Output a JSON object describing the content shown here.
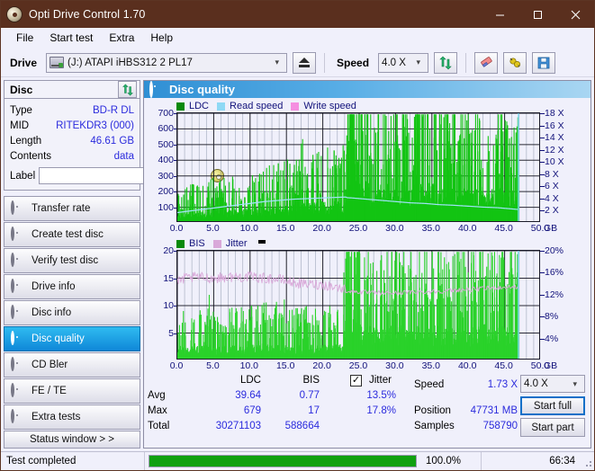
{
  "window": {
    "title": "Opti Drive Control 1.70",
    "icon": "disc-icon",
    "minimize": "minimize-icon",
    "maximize": "maximize-icon",
    "close": "close-icon"
  },
  "menu": {
    "items": [
      "File",
      "Start test",
      "Extra",
      "Help"
    ]
  },
  "toolbar": {
    "drive_label": "Drive",
    "drive_value": "(J:)  ATAPI iHBS312  2 PL17",
    "eject_icon": "eject-icon",
    "speed_label": "Speed",
    "speed_value": "4.0 X",
    "refresh_icon": "refresh-icon",
    "eraser_icon": "eraser-icon",
    "bug_icon": "bug-icon",
    "save_icon": "save-icon"
  },
  "disc": {
    "header": "Disc",
    "refresh_icon": "refresh-icon",
    "rows": [
      {
        "key": "Type",
        "value": "BD-R DL"
      },
      {
        "key": "MID",
        "value": "RITEKDR3 (000)"
      },
      {
        "key": "Length",
        "value": "46.61 GB"
      },
      {
        "key": "Contents",
        "value": "data"
      }
    ],
    "label_key": "Label",
    "label_value": "",
    "label_placeholder": "",
    "label_button_icon": "cd-icon"
  },
  "nav": {
    "items": [
      {
        "label": "Transfer rate",
        "icon": "disc-icon",
        "active": false
      },
      {
        "label": "Create test disc",
        "icon": "disc-icon",
        "active": false
      },
      {
        "label": "Verify test disc",
        "icon": "disc-icon",
        "active": false
      },
      {
        "label": "Drive info",
        "icon": "disc-icon",
        "active": false
      },
      {
        "label": "Disc info",
        "icon": "disc-icon",
        "active": false
      },
      {
        "label": "Disc quality",
        "icon": "disc-icon",
        "active": true
      },
      {
        "label": "CD Bler",
        "icon": "disc-icon",
        "active": false
      },
      {
        "label": "FE / TE",
        "icon": "disc-icon",
        "active": false
      },
      {
        "label": "Extra tests",
        "icon": "disc-icon",
        "active": false
      }
    ],
    "status_window": "Status window > >"
  },
  "panel": {
    "title": "Disc quality",
    "icon": "disc-icon"
  },
  "stats": {
    "col_ldc": "LDC",
    "col_bis": "BIS",
    "jitter_label": "Jitter",
    "jitter_checked": true,
    "row_avg": "Avg",
    "row_max": "Max",
    "row_total": "Total",
    "ldc_avg": "39.64",
    "ldc_max": "679",
    "ldc_total": "30271103",
    "bis_avg": "0.77",
    "bis_max": "17",
    "bis_total": "588664",
    "jitter_avg": "13.5%",
    "jitter_max": "17.8%",
    "speed_label": "Speed",
    "speed_value": "1.73 X",
    "position_label": "Position",
    "position_value": "47731 MB",
    "samples_label": "Samples",
    "samples_value": "758790",
    "speed_select": "4.0 X",
    "start_full": "Start full",
    "start_part": "Start part"
  },
  "statusbar": {
    "message": "Test completed",
    "percent_text": "100.0%",
    "percent_value": 100,
    "elapsed": "66:34"
  },
  "colors": {
    "title_bar": "#5a2f1e",
    "accent": "#1170c8",
    "ldc_green": "#13c413",
    "bis_green": "#13c413",
    "read_speed": "#8fd9f5",
    "write_speed": "#f58fe0",
    "jitter": "#d9a8d9",
    "plot_bg": "#616d86",
    "value_blue": "#2b2bdd",
    "progress_green": "#10a010"
  },
  "chart_data": [
    {
      "type": "line",
      "id": "ldc-chart",
      "title": "",
      "legend": [
        {
          "label": "LDC",
          "color": "#0a8a0a"
        },
        {
          "label": "Read speed",
          "color": "#8fd9f5"
        },
        {
          "label": "Write speed",
          "color": "#f58fe0"
        }
      ],
      "legend_position": "top-left",
      "grid": true,
      "xlabel": "GB",
      "xlim": [
        0,
        50
      ],
      "xticks": [
        0.0,
        5.0,
        10.0,
        15.0,
        20.0,
        25.0,
        30.0,
        35.0,
        40.0,
        45.0,
        50.0
      ],
      "xticklabels": [
        "0.0",
        "5.0",
        "10.0",
        "15.0",
        "20.0",
        "25.0",
        "30.0",
        "35.0",
        "40.0",
        "45.0",
        "50.0"
      ],
      "ylabel": "",
      "ylim": [
        0,
        700
      ],
      "yticks": [
        100,
        200,
        300,
        400,
        500,
        600,
        700
      ],
      "yticklabels": [
        "100",
        "200",
        "300",
        "400",
        "500",
        "600",
        "700"
      ],
      "y2label": "",
      "y2lim": [
        0,
        18
      ],
      "y2ticks": [
        2,
        4,
        6,
        8,
        10,
        12,
        14,
        16,
        18
      ],
      "y2ticklabels": [
        "2 X",
        "4 X",
        "6 X",
        "8 X",
        "10 X",
        "12 X",
        "14 X",
        "16 X",
        "18 X"
      ],
      "data_end_gb": 46.9,
      "series": [
        {
          "name": "LDC",
          "type": "bar",
          "color": "#13c413",
          "axis": "left",
          "x": [
            0.3,
            0.8,
            1.3,
            1.8,
            2.3,
            2.8,
            3.3,
            3.8,
            4.3,
            4.8,
            5.3,
            5.8,
            6.3,
            6.8,
            7.3,
            7.8,
            8.3,
            8.8,
            9.3,
            9.8,
            10.3,
            10.8,
            11.3,
            11.8,
            12.3,
            12.8,
            13.3,
            13.8,
            14.3,
            14.8,
            15.3,
            15.8,
            16.3,
            16.8,
            17.3,
            17.8,
            18.3,
            18.8,
            19.3,
            19.8,
            20.3,
            20.8,
            21.3,
            21.8,
            22.3,
            22.8,
            23.1,
            23.3,
            23.5,
            23.7,
            23.9,
            24.1,
            24.4,
            24.8,
            25.2,
            25.6,
            26.0,
            26.5,
            27.0,
            27.5,
            28.0,
            28.5,
            29.0,
            29.5,
            30.0,
            30.5,
            31.0,
            31.5,
            32.0,
            32.5,
            33.0,
            33.5,
            34.0,
            34.5,
            35.0,
            35.5,
            36.0,
            36.5,
            37.0,
            37.5,
            38.0,
            38.5,
            39.0,
            39.5,
            40.0,
            40.5,
            41.0,
            41.5,
            42.0,
            42.5,
            43.0,
            43.5,
            44.0,
            44.5,
            45.0,
            45.5,
            46.0,
            46.5,
            46.9
          ],
          "baseline": [
            60,
            70,
            75,
            80,
            85,
            90,
            85,
            80,
            90,
            95,
            95,
            100,
            95,
            90,
            95,
            100,
            100,
            105,
            105,
            110,
            110,
            115,
            110,
            115,
            120,
            120,
            125,
            125,
            130,
            130,
            135,
            135,
            140,
            140,
            145,
            145,
            150,
            150,
            155,
            155,
            160,
            160,
            165,
            165,
            170,
            170,
            175,
            300,
            260,
            420,
            690,
            650,
            620,
            520,
            470,
            300,
            330,
            260,
            230,
            310,
            280,
            250,
            300,
            230,
            260,
            300,
            340,
            280,
            230,
            260,
            430,
            300,
            260,
            300,
            340,
            260,
            230,
            250,
            280,
            230,
            260,
            240,
            230,
            250,
            260,
            230,
            250,
            230,
            260,
            240,
            250,
            230,
            260,
            240,
            230,
            250,
            230,
            240,
            230
          ],
          "spikes_note": "dense vertical bars from 0 to data end; error rate rises sharply after 23.1 GB (layer break), peaks near 690 around 24 GB"
        },
        {
          "name": "Read speed",
          "type": "line",
          "color": "#9fe3f8",
          "axis": "right",
          "x": [
            0.0,
            2.0,
            4.0,
            6.0,
            8.0,
            10.0,
            12.0,
            14.0,
            16.0,
            18.0,
            20.0,
            22.0,
            23.2,
            23.3,
            24.0,
            26.0,
            28.0,
            30.0,
            32.0,
            34.0,
            36.0,
            38.0,
            40.0,
            42.0,
            44.0,
            46.0,
            46.9
          ],
          "values": [
            1.7,
            2.0,
            2.3,
            2.6,
            2.9,
            3.2,
            3.5,
            3.7,
            3.9,
            4.0,
            4.1,
            4.2,
            4.25,
            4.15,
            4.1,
            3.9,
            3.7,
            3.5,
            3.3,
            3.2,
            3.0,
            2.9,
            2.75,
            2.6,
            2.5,
            2.3,
            2.2
          ]
        },
        {
          "name": "Write speed",
          "type": "line",
          "color": "#f58fe0",
          "axis": "right",
          "x": [],
          "values": []
        }
      ]
    },
    {
      "type": "line",
      "id": "bis-jitter-chart",
      "title": "",
      "legend": [
        {
          "label": "BIS",
          "color": "#0a8a0a"
        },
        {
          "label": "Jitter",
          "color": "#d9a8d9"
        }
      ],
      "legend_position": "top-left",
      "grid": true,
      "xlabel": "GB",
      "xlim": [
        0,
        50
      ],
      "xticks": [
        0.0,
        5.0,
        10.0,
        15.0,
        20.0,
        25.0,
        30.0,
        35.0,
        40.0,
        45.0,
        50.0
      ],
      "xticklabels": [
        "0.0",
        "5.0",
        "10.0",
        "15.0",
        "20.0",
        "25.0",
        "30.0",
        "35.0",
        "40.0",
        "45.0",
        "50.0"
      ],
      "ylim": [
        0,
        20
      ],
      "yticks": [
        5,
        10,
        15,
        20
      ],
      "yticklabels": [
        "5",
        "10",
        "15",
        "20"
      ],
      "y2lim": [
        0,
        20
      ],
      "y2ticks": [
        4,
        8,
        12,
        16,
        20
      ],
      "y2ticklabels": [
        "4%",
        "8%",
        "12%",
        "16%",
        "20%"
      ],
      "data_end_gb": 46.9,
      "series": [
        {
          "name": "BIS",
          "type": "bar",
          "color": "#13c413",
          "axis": "left",
          "x": [
            0.5,
            1.5,
            2.5,
            3.5,
            4.5,
            5.5,
            6.5,
            7.5,
            8.5,
            9.5,
            10.5,
            11.5,
            12.5,
            13.5,
            14.5,
            15.5,
            16.5,
            17.5,
            18.5,
            19.5,
            20.5,
            21.5,
            22.5,
            23.2,
            23.5,
            24.0,
            25.0,
            26.0,
            27.0,
            28.0,
            29.0,
            30.0,
            31.0,
            32.0,
            33.0,
            34.0,
            35.0,
            36.0,
            37.0,
            38.0,
            39.0,
            40.0,
            41.0,
            42.0,
            43.0,
            44.0,
            45.0,
            46.0,
            46.9
          ],
          "baseline": [
            3,
            3,
            3,
            3.2,
            3.2,
            3,
            3,
            3.2,
            3.2,
            3.2,
            3.2,
            3.5,
            3.5,
            3.5,
            3.2,
            3.2,
            3.2,
            3.2,
            3.2,
            3.2,
            3.2,
            3.5,
            3.5,
            11,
            17,
            12,
            8,
            7,
            7,
            6.5,
            7,
            8,
            7,
            6.5,
            7,
            7,
            7.5,
            7,
            7,
            6.5,
            7,
            7,
            7,
            7.5,
            7,
            7,
            7,
            7,
            6.5
          ],
          "spikes_note": "dense low green bars ~3-5 before 23 GB, rising to ~6-8 after layer change with occasional spikes to 16"
        },
        {
          "name": "Jitter",
          "type": "line",
          "color": "#d9a8d9",
          "axis": "right",
          "x": [
            0.0,
            0.5,
            1.0,
            2.0,
            3.0,
            4.0,
            5.0,
            6.0,
            7.0,
            8.0,
            9.0,
            10.0,
            11.0,
            12.0,
            13.0,
            14.0,
            15.0,
            16.0,
            17.0,
            18.0,
            19.0,
            20.0,
            21.0,
            22.0,
            23.0,
            23.3,
            24.0,
            25.0,
            26.0,
            27.0,
            28.0,
            29.0,
            30.0,
            31.0,
            32.0,
            33.0,
            34.0,
            35.0,
            36.0,
            37.0,
            38.0,
            39.0,
            40.0,
            41.0,
            42.0,
            43.0,
            44.0,
            45.0,
            46.0,
            46.9
          ],
          "values": [
            14.2,
            14.6,
            15.0,
            15.1,
            15.2,
            15.1,
            15.0,
            15.1,
            15.2,
            15.3,
            15.2,
            15.3,
            15.1,
            15.0,
            14.9,
            14.8,
            14.5,
            14.2,
            14.0,
            13.9,
            13.9,
            13.8,
            13.6,
            13.3,
            13.0,
            12.7,
            12.6,
            12.5,
            12.4,
            12.3,
            12.3,
            12.3,
            12.3,
            12.4,
            12.4,
            12.5,
            12.5,
            12.6,
            12.6,
            12.7,
            12.8,
            12.9,
            12.9,
            13.0,
            13.1,
            13.2,
            13.3,
            13.3,
            13.4,
            13.4
          ]
        }
      ]
    }
  ]
}
